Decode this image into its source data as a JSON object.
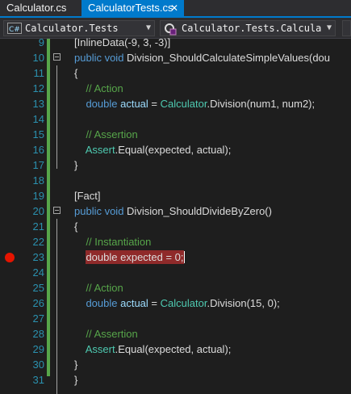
{
  "tabs": [
    {
      "label": "Calculator.cs",
      "active": false
    },
    {
      "label": "CalculatorTests.cs",
      "active": true
    }
  ],
  "tab_close_glyph": "✕",
  "nav": {
    "project_icon": "C#",
    "project": "Calculator.Tests",
    "type_icon": "class-icon",
    "type": "Calculator.Tests.Calcula"
  },
  "colors": {
    "accent": "#007acc",
    "breakpoint": "#e51400",
    "highlight": "#8f2a2a",
    "comment": "#57a64a",
    "keyword": "#569cd6",
    "type": "#4ec9b0"
  },
  "lines": [
    {
      "n": "9",
      "tokens": [
        [
          "pl",
          "[InlineData(-9, 3, -3)]"
        ]
      ]
    },
    {
      "n": "10",
      "tokens": [
        [
          "kw",
          "public "
        ],
        [
          "kw",
          "void "
        ],
        [
          "pl",
          "Division_ShouldCalculateSimpleValues(dou"
        ]
      ]
    },
    {
      "n": "11",
      "tokens": [
        [
          "pl",
          "{"
        ]
      ]
    },
    {
      "n": "12",
      "tokens": [
        [
          "cm",
          "    // Action"
        ]
      ]
    },
    {
      "n": "13",
      "tokens": [
        [
          "kw",
          "    double "
        ],
        [
          "vr",
          "actual "
        ],
        [
          "pl",
          "= "
        ],
        [
          "ty",
          "Calculator"
        ],
        [
          "pl",
          ".Division(num1, num2);"
        ]
      ]
    },
    {
      "n": "14",
      "tokens": []
    },
    {
      "n": "15",
      "tokens": [
        [
          "cm",
          "    // Assertion"
        ]
      ]
    },
    {
      "n": "16",
      "tokens": [
        [
          "ty",
          "    Assert"
        ],
        [
          "pl",
          ".Equal(expected, actual);"
        ]
      ]
    },
    {
      "n": "17",
      "tokens": [
        [
          "pl",
          "}"
        ]
      ]
    },
    {
      "n": "18",
      "tokens": []
    },
    {
      "n": "19",
      "tokens": [
        [
          "pl",
          "[Fact]"
        ]
      ]
    },
    {
      "n": "20",
      "tokens": [
        [
          "kw",
          "public "
        ],
        [
          "kw",
          "void "
        ],
        [
          "pl",
          "Division_ShouldDivideByZero()"
        ]
      ]
    },
    {
      "n": "21",
      "tokens": [
        [
          "pl",
          "{"
        ]
      ]
    },
    {
      "n": "22",
      "tokens": [
        [
          "cm",
          "    // Instantiation"
        ]
      ]
    },
    {
      "n": "23",
      "tokens": [
        [
          "pl",
          "    "
        ],
        [
          "hl",
          "double expected = 0;"
        ]
      ]
    },
    {
      "n": "24",
      "tokens": []
    },
    {
      "n": "25",
      "tokens": [
        [
          "cm",
          "    // Action"
        ]
      ]
    },
    {
      "n": "26",
      "tokens": [
        [
          "kw",
          "    double "
        ],
        [
          "vr",
          "actual "
        ],
        [
          "pl",
          "= "
        ],
        [
          "ty",
          "Calculator"
        ],
        [
          "pl",
          ".Division(15, 0);"
        ]
      ]
    },
    {
      "n": "27",
      "tokens": []
    },
    {
      "n": "28",
      "tokens": [
        [
          "cm",
          "    // Assertion"
        ]
      ]
    },
    {
      "n": "29",
      "tokens": [
        [
          "ty",
          "    Assert"
        ],
        [
          "pl",
          ".Equal(expected, actual);"
        ]
      ]
    },
    {
      "n": "30",
      "tokens": [
        [
          "pl",
          "}"
        ]
      ]
    },
    {
      "n": "31",
      "tokens": [
        [
          "pl",
          "}"
        ]
      ]
    }
  ]
}
